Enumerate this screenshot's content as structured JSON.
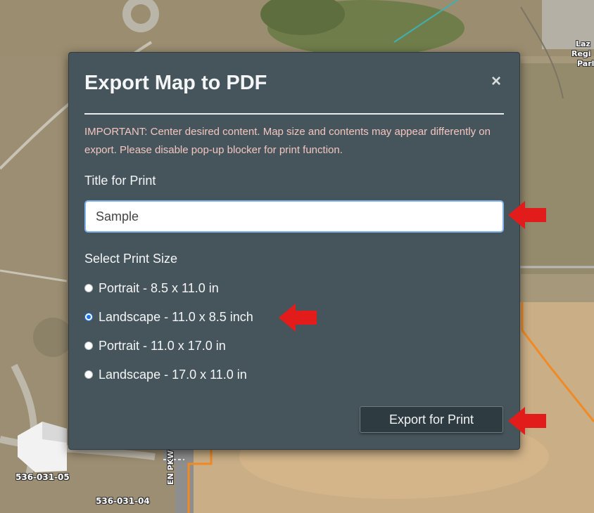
{
  "dialog": {
    "title": "Export Map to PDF",
    "close_symbol": "×",
    "notice": "IMPORTANT: Center desired content. Map size and contents may appear differently on export. Please disable pop-up blocker for print function.",
    "title_label": "Title for Print",
    "title_value": "Sample",
    "size_label": "Select Print Size",
    "sizes": [
      {
        "label": "Portrait - 8.5 x 11.0 in",
        "checked": false
      },
      {
        "label": "Landscape - 11.0 x 8.5 inch",
        "checked": true
      },
      {
        "label": "Portrait - 11.0 x 17.0 in",
        "checked": false
      },
      {
        "label": "Landscape - 17.0 x 11.0 in",
        "checked": false
      }
    ],
    "export_label": "Export for Print"
  },
  "map": {
    "parcel_labels": [
      "536-031-05",
      "536-031-04"
    ],
    "street_labels": [
      "EN PKWY",
      "Laz",
      "Regi",
      "Parl"
    ]
  },
  "colors": {
    "dialog_bg": "#46555b",
    "notice_text": "#f2c6c0",
    "parcel_outline": "#f08a24",
    "annotation_arrow": "#e21b1b"
  }
}
